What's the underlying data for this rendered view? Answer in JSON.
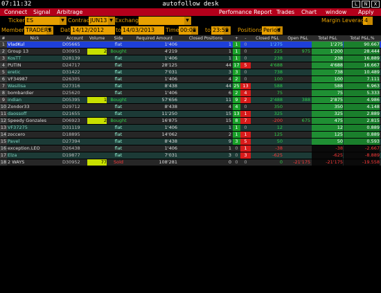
{
  "titlebar": {
    "clock": "07:11:32",
    "title": "autofollow desk",
    "buttons": [
      "L",
      "N",
      "X"
    ]
  },
  "menu": {
    "connect": "Connect",
    "signal": "Signal",
    "arbitrage": "Arbitrage",
    "perf": "Perfomance Report",
    "trades": "Trades",
    "chart": "Chart",
    "window": "window",
    "apply": "Apply"
  },
  "filters": {
    "ticker_label": "Ticker",
    "ticker": "ES",
    "contract_label": "Contract",
    "contract": "JUN13",
    "exchange_label": "Exchange",
    "exchange": "",
    "margin_label": "Margin Leverage",
    "margin": "4",
    "members_label": "Members",
    "members": "TRADERS",
    "date_label": "Date",
    "date_from": "14/12/2012",
    "to_label": "to",
    "date_to": "14/03/2013",
    "time_label": "Time",
    "time_from": "00:00",
    "time_to": "23:59",
    "positions_label": "Positions",
    "positions": "Period"
  },
  "columns": [
    "#",
    "Nick",
    "Account",
    "Volume",
    "Side",
    "Required Amount",
    "Closed Positions",
    "+",
    "-",
    "Closed P&L",
    "Open P&L",
    "Total P&L",
    "Total P&L,%"
  ],
  "rows": [
    [
      "1",
      "VladKul",
      "D05665",
      "",
      "flat",
      "1'406",
      "1",
      "1",
      "0",
      "1'275",
      "",
      "1'275",
      "90.667"
    ],
    [
      "2",
      "Group 13",
      "D30953",
      "2",
      "Bought",
      "4'219",
      "1",
      "1",
      "0",
      "225",
      "975",
      "1'200",
      "28.444"
    ],
    [
      "3",
      "KosTT",
      "D28139",
      "",
      "flat",
      "1'406",
      "1",
      "1",
      "0",
      "238",
      "",
      "238",
      "16.889"
    ],
    [
      "4",
      "PUTIN",
      "D24717",
      "",
      "flat",
      "28'125",
      "44",
      "17",
      "5",
      "4'688",
      "",
      "4'688",
      "16.667"
    ],
    [
      "5",
      "eretic",
      "D31422",
      "",
      "flat",
      "7'031",
      "3",
      "3",
      "0",
      "738",
      "",
      "738",
      "10.489"
    ],
    [
      "6",
      "VF34987",
      "D26305",
      "",
      "flat",
      "1'406",
      "4",
      "2",
      "0",
      "100",
      "",
      "100",
      "7.111"
    ],
    [
      "7",
      "Wasilisa",
      "D27316",
      "",
      "flat",
      "8'438",
      "44",
      "25",
      "13",
      "588",
      "",
      "588",
      "6.963"
    ],
    [
      "8",
      "bombardier",
      "D25620",
      "",
      "flat",
      "1'406",
      "6",
      "2",
      "4",
      "75",
      "",
      "75",
      "5.333"
    ],
    [
      "9",
      "indian",
      "D05395",
      "1",
      "Bought",
      "57'656",
      "11",
      "9",
      "2",
      "2'488",
      "388",
      "2'875",
      "4.986"
    ],
    [
      "10",
      "Zondor33",
      "D29712",
      "",
      "flat",
      "8'438",
      "4",
      "4",
      "0",
      "350",
      "",
      "350",
      "4.148"
    ],
    [
      "11",
      "daossoff",
      "D21655",
      "",
      "flat",
      "11'250",
      "15",
      "13",
      "1",
      "325",
      "",
      "325",
      "2.889"
    ],
    [
      "12",
      "Speedy Gonzales",
      "D06923",
      "2",
      "Bought",
      "16'875",
      "15",
      "8",
      "7",
      "-200",
      "675",
      "475",
      "2.815"
    ],
    [
      "13",
      "VF37275",
      "D31119",
      "",
      "flat",
      "1'406",
      "1",
      "1",
      "0",
      "12",
      "",
      "12",
      "0.889"
    ],
    [
      "14",
      "zoccero",
      "D18895",
      "",
      "flat",
      "14'062",
      "2",
      "1",
      "1",
      "125",
      "",
      "125",
      "0.889"
    ],
    [
      "15",
      "Pavel",
      "D27394",
      "",
      "flat",
      "8'438",
      "9",
      "3",
      "5",
      "50",
      "",
      "50",
      "0.593"
    ],
    [
      "16",
      "exception.LEO",
      "D26438",
      "",
      "flat",
      "1'406",
      "1",
      "0",
      "1",
      "-38",
      "",
      "-38",
      "-2.667"
    ],
    [
      "17",
      "Elza",
      "D19877",
      "",
      "flat",
      "7'031",
      "3",
      "0",
      "3",
      "-625",
      "",
      "-625",
      "-8.889"
    ],
    [
      "18",
      "2 WAYS",
      "D30952",
      "77",
      "Sold",
      "108'281",
      "0",
      "0",
      "0",
      "0",
      "-21'175",
      "-21'175",
      "-19.558"
    ]
  ],
  "colors": {
    "menubar": "#b3001b",
    "accent": "#e8a000",
    "positive": "#2fd14a",
    "negative": "#ff3b3b",
    "selected": "#1e3fd8"
  }
}
